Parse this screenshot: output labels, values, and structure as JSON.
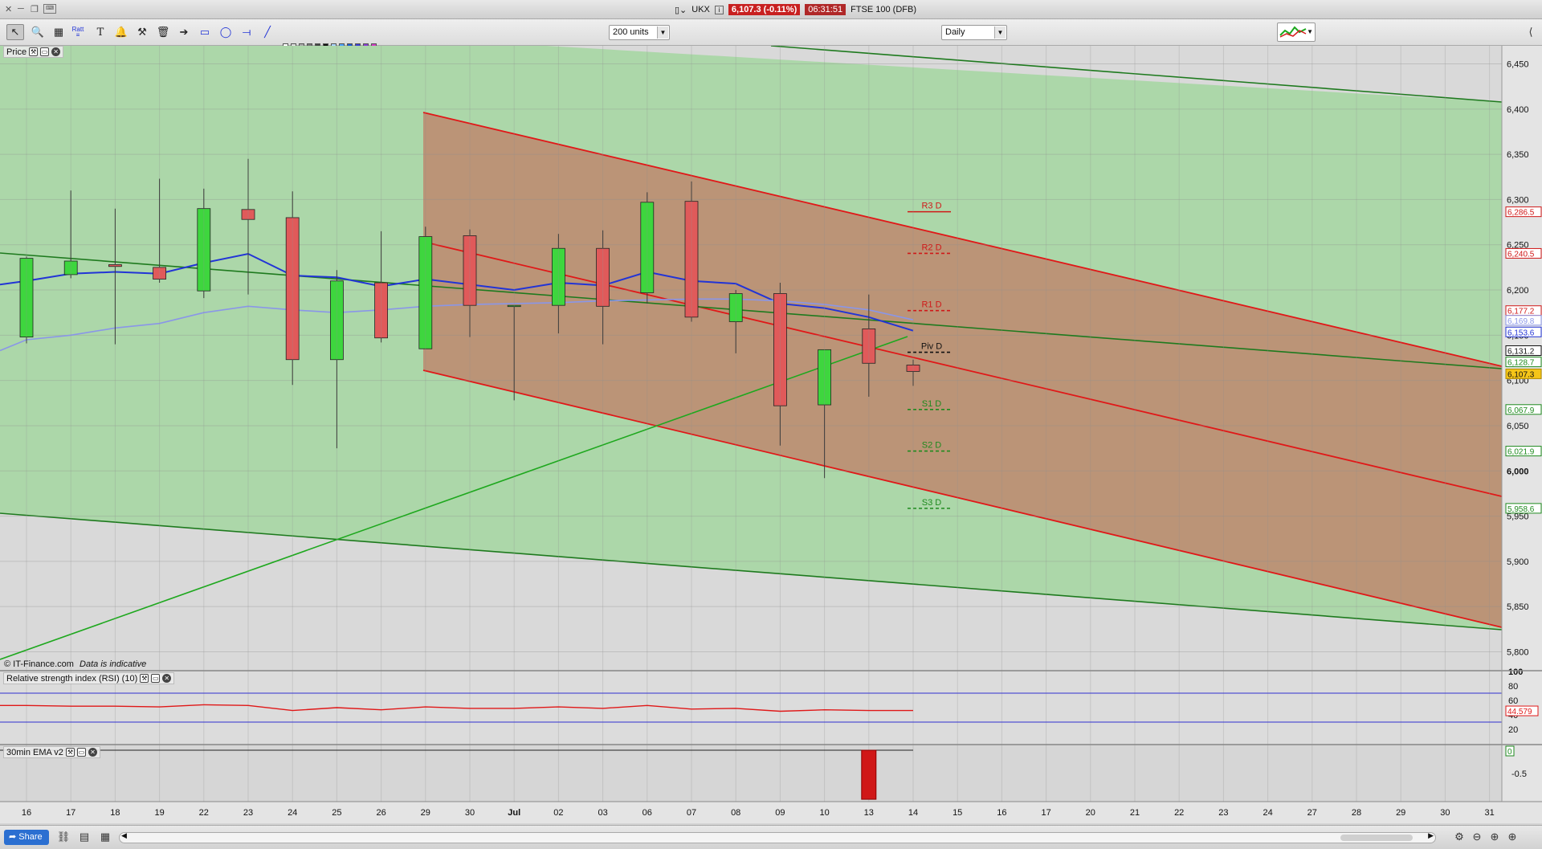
{
  "window": {
    "title_symbol": "UKX",
    "title_price": "6,107.3 (-0.11%)",
    "title_time": "06:31:51",
    "title_instrument": "FTSE 100 (DFB)"
  },
  "toolbar": {
    "units_select": "200 units",
    "timeframe_select": "Daily",
    "fib_label": "Ratt"
  },
  "price_panel": {
    "label": "Price",
    "watermark": "© IT-Finance.com",
    "watermark_note": "Data is indicative",
    "y_ticks": [
      "6,450",
      "6,400",
      "6,350",
      "6,300",
      "6,250",
      "6,200",
      "6,150",
      "6,100",
      "6,050",
      "6,000",
      "5,950",
      "5,900",
      "5,850",
      "5,800"
    ],
    "y_tick_values": [
      6450,
      6400,
      6350,
      6300,
      6250,
      6200,
      6150,
      6100,
      6050,
      6000,
      5950,
      5900,
      5850,
      5800
    ],
    "ylim": [
      5780,
      6470
    ],
    "price_tags": [
      {
        "text": "6,286.5",
        "value": 6286.5,
        "bg": "#ffffff",
        "fg": "#d01818",
        "border": "#d01818"
      },
      {
        "text": "6,240.5",
        "value": 6240.5,
        "bg": "#ffffff",
        "fg": "#d01818",
        "border": "#d01818"
      },
      {
        "text": "6,177.2",
        "value": 6177.2,
        "bg": "#ffffff",
        "fg": "#d01818",
        "border": "#d01818"
      },
      {
        "text": "6,169.8",
        "value": 6166.5,
        "bg": "#ffffff",
        "fg": "#8a96e8",
        "border": "#8a96e8"
      },
      {
        "text": "6,153.6",
        "value": 6153.6,
        "bg": "#ffffff",
        "fg": "#2234d6",
        "border": "#2234d6"
      },
      {
        "text": "6,131.2",
        "value": 6133,
        "bg": "#ffffff",
        "fg": "#111111",
        "border": "#111111"
      },
      {
        "text": "6,128.7",
        "value": 6120.5,
        "bg": "#ffffff",
        "fg": "#1e8a1e",
        "border": "#1e8a1e"
      },
      {
        "text": "6,107.3",
        "value": 6107.3,
        "bg": "#f5c518",
        "fg": "#111111",
        "border": "#b08a00"
      },
      {
        "text": "6,067.9",
        "value": 6067.9,
        "bg": "#ffffff",
        "fg": "#1e8a1e",
        "border": "#1e8a1e"
      },
      {
        "text": "6,021.9",
        "value": 6021.9,
        "bg": "#ffffff",
        "fg": "#1e8a1e",
        "border": "#1e8a1e"
      },
      {
        "text": "5,958.6",
        "value": 5958.6,
        "bg": "#ffffff",
        "fg": "#1e8a1e",
        "border": "#1e8a1e"
      }
    ],
    "pivots": [
      {
        "label": "R3 D",
        "value": 6286.5,
        "color": "#d01818",
        "dashed": false
      },
      {
        "label": "R2 D",
        "value": 6240.5,
        "color": "#d01818",
        "dashed": true
      },
      {
        "label": "R1 D",
        "value": 6177.2,
        "color": "#d01818",
        "dashed": true
      },
      {
        "label": "Piv D",
        "value": 6131.2,
        "color": "#111111",
        "dashed": true
      },
      {
        "label": "S1 D",
        "value": 6067.9,
        "color": "#1e8a1e",
        "dashed": true
      },
      {
        "label": "S2 D",
        "value": 6021.9,
        "color": "#1e8a1e",
        "dashed": true
      },
      {
        "label": "S3 D",
        "value": 5958.6,
        "color": "#1e8a1e",
        "dashed": true
      }
    ]
  },
  "rsi_panel": {
    "label": "Relative strength index (RSI) (10)",
    "ticks": [
      "100",
      "80",
      "60",
      "40",
      "20"
    ],
    "tick_values": [
      100,
      80,
      60,
      40,
      20
    ],
    "current_value": "44.579",
    "upper": 70,
    "lower": 30
  },
  "ema_panel": {
    "label": "30min EMA v2",
    "ticks": [
      "0",
      "-0.5"
    ],
    "tick_values": [
      0,
      -0.5
    ]
  },
  "x_axis": {
    "labels": [
      "16",
      "17",
      "18",
      "19",
      "22",
      "23",
      "24",
      "25",
      "26",
      "29",
      "30",
      "Jul",
      "02",
      "03",
      "06",
      "07",
      "08",
      "09",
      "10",
      "13",
      "14",
      "15",
      "16",
      "17",
      "20",
      "21",
      "22",
      "23",
      "24",
      "27",
      "28",
      "29",
      "30",
      "31"
    ]
  },
  "bottom": {
    "share_label": "Share"
  },
  "chart_data": {
    "type": "candlestick",
    "title": "",
    "categories": [
      "16",
      "17",
      "18",
      "19",
      "22",
      "23",
      "24",
      "25",
      "26",
      "29",
      "30",
      "Jul",
      "02",
      "03",
      "06",
      "07",
      "08",
      "09",
      "10",
      "13",
      "14"
    ],
    "series": [
      {
        "name": "",
        "ohlc": [
          [
            6148,
            6237,
            6141,
            6235
          ],
          [
            6217,
            6310,
            6213,
            6232
          ],
          [
            6228,
            6290,
            6140,
            6226
          ],
          [
            6225,
            6323,
            6208,
            6212
          ],
          [
            6199,
            6312,
            6191,
            6290
          ],
          [
            6289,
            6345,
            6195,
            6278
          ],
          [
            6280,
            6309,
            6095,
            6123
          ],
          [
            6123,
            6222,
            6025,
            6210
          ],
          [
            6208,
            6265,
            6142,
            6147
          ],
          [
            6135,
            6270,
            6135,
            6259
          ],
          [
            6260,
            6267,
            6148,
            6183
          ],
          [
            6183,
            6183,
            6078,
            6183
          ],
          [
            6183,
            6262,
            6152,
            6246
          ],
          [
            6246,
            6266,
            6140,
            6182
          ],
          [
            6197,
            6308,
            6185,
            6297
          ],
          [
            6298,
            6320,
            6165,
            6170
          ],
          [
            6165,
            6200,
            6130,
            6196
          ],
          [
            6196,
            6208,
            6028,
            6072
          ],
          [
            6073,
            6133,
            5992,
            6134
          ],
          [
            6157,
            6195,
            6082,
            6119
          ],
          [
            6117,
            6123,
            6094,
            6110
          ]
        ]
      },
      {
        "name": "",
        "type": "line",
        "color": "#2234d6",
        "values": [
          6210,
          6218,
          6220,
          6218,
          6230,
          6240,
          6216,
          6214,
          6204,
          6212,
          6206,
          6200,
          6208,
          6205,
          6220,
          6210,
          6207,
          6185,
          6180,
          6170,
          6155
        ]
      },
      {
        "name": "",
        "type": "line",
        "color": "#8a96e8",
        "values": [
          6145,
          6150,
          6158,
          6163,
          6175,
          6182,
          6178,
          6175,
          6178,
          6182,
          6184,
          6185,
          6186,
          6188,
          6189,
          6190,
          6190,
          6188,
          6184,
          6178,
          6167
        ]
      }
    ],
    "rsi": [
      53,
      52,
      52,
      51,
      54,
      53,
      46,
      50,
      47,
      51,
      49,
      49,
      51,
      49,
      53,
      48,
      49,
      45,
      47,
      46,
      46
    ],
    "ema_histogram": {
      "category": "13",
      "value": -1.05
    },
    "ylim": [
      5780,
      6470
    ],
    "grid": true,
    "legend": "none"
  }
}
